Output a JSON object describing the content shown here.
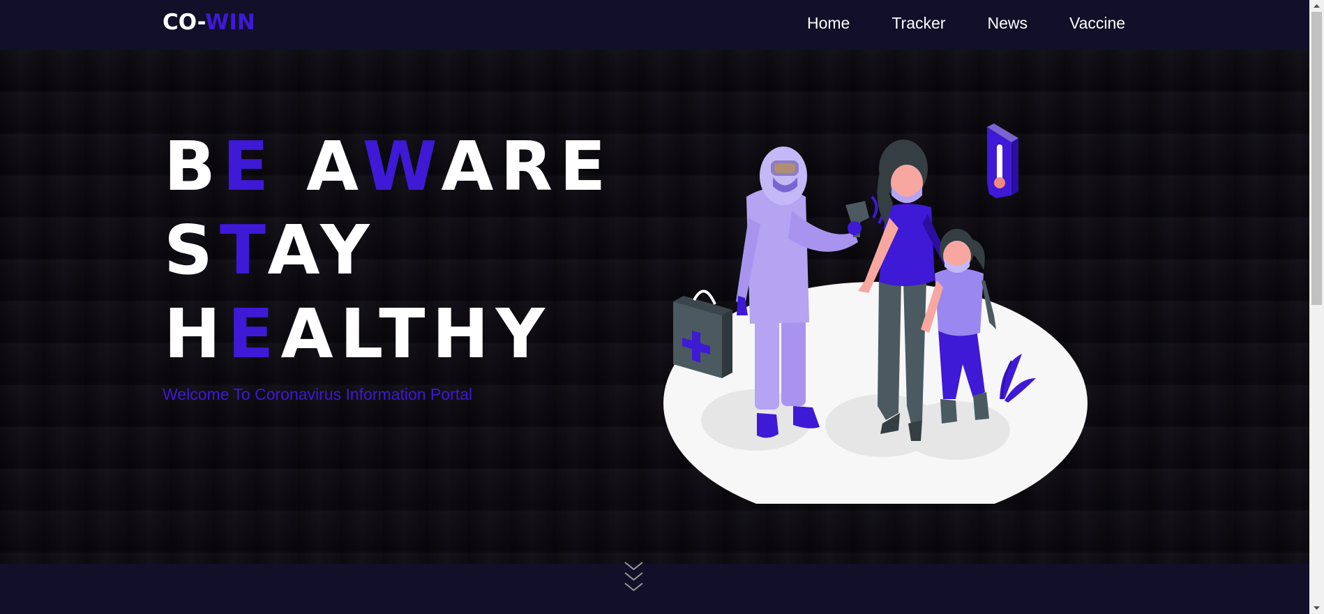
{
  "navbar": {
    "logo_main": "CO-",
    "logo_accent": "WIN",
    "links": [
      {
        "label": "Home"
      },
      {
        "label": "Tracker"
      },
      {
        "label": "News"
      },
      {
        "label": "Vaccine"
      }
    ]
  },
  "hero": {
    "line1": {
      "p1": "B",
      "h1": "E",
      "p2": " A",
      "h2": "W",
      "p3": "ARE"
    },
    "line2": {
      "p1": "S",
      "h1": "T",
      "p2": "AY"
    },
    "line3": {
      "p1": "H",
      "h1": "E",
      "p2": "ALTHY"
    },
    "subtitle": "Welcome To Coronavirus Information Portal"
  },
  "icons": {
    "illustration": "health-worker-temperature-check-illustration",
    "mouse": "mouse-scroll-icon",
    "chevrons": "chevron-down-triple-icon"
  },
  "colors": {
    "accent": "#3e19d6",
    "navbar_bg": "#120f29",
    "hero_bg": "#0d0b12",
    "text": "#ffffff"
  }
}
